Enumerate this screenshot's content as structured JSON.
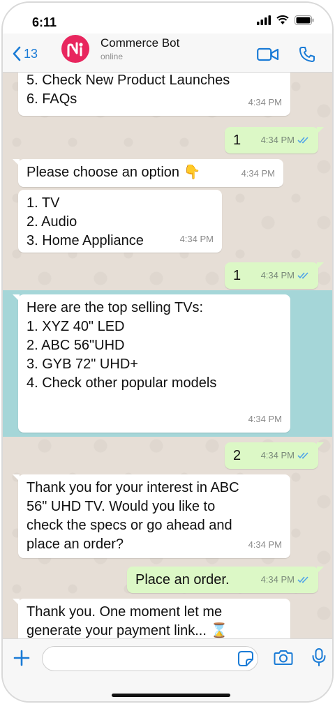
{
  "status_bar": {
    "time": "6:11"
  },
  "header": {
    "back_count": "13",
    "contact_name": "Commerce Bot",
    "contact_status": "online"
  },
  "messages": [
    {
      "dir": "in",
      "lines": [
        "5. Check New Product Launches",
        "6. FAQs"
      ],
      "time": "4:34 PM"
    },
    {
      "dir": "out",
      "text": "1",
      "time": "4:34 PM"
    },
    {
      "dir": "in",
      "lines": [
        "Please choose an option 👇"
      ],
      "time": "4:34 PM"
    },
    {
      "dir": "in",
      "lines": [
        "1. TV",
        "2. Audio",
        "3. Home Appliance"
      ],
      "time": "4:34 PM"
    },
    {
      "dir": "out",
      "text": "1",
      "time": "4:34 PM"
    },
    {
      "dir": "in",
      "lines": [
        "Here are the top selling TVs:",
        "",
        "1. XYZ 40\" LED",
        "2. ABC 56\"UHD",
        "3. GYB 72\" UHD+",
        "4. Check other popular models"
      ],
      "time": "4:34 PM"
    },
    {
      "dir": "out",
      "text": "2",
      "time": "4:34 PM"
    },
    {
      "dir": "in",
      "lines": [
        "Thank you for your interest in ABC",
        "56\" UHD TV. Would you like to",
        "check the specs or go ahead and",
        "place an order?"
      ],
      "time": "4:34 PM"
    },
    {
      "dir": "out",
      "text": "Place an order.",
      "time": "4:34 PM"
    },
    {
      "dir": "in",
      "lines": [
        "Thank you. One moment let me",
        "generate your payment link... ⌛"
      ],
      "time": ""
    }
  ],
  "composer": {
    "placeholder": ""
  },
  "colors": {
    "accent": "#1a7bd6",
    "outgoing": "#dcf8c6",
    "highlight": "#a5d6d8",
    "avatar": "#e8265e"
  },
  "icons": [
    "chevron-left-icon",
    "video-icon",
    "phone-icon",
    "plus-icon",
    "sticker-icon",
    "camera-icon",
    "mic-icon",
    "double-check-icon",
    "signal-icon",
    "wifi-icon",
    "battery-icon"
  ]
}
